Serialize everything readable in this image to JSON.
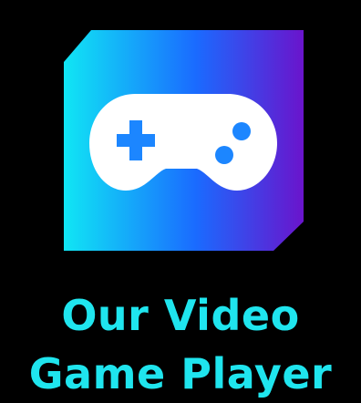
{
  "logo": {
    "icon": "gamepad-icon",
    "gradient": [
      "#10e6f4",
      "#1a6bff",
      "#6a14cc"
    ],
    "glyph_color": "#ffffff",
    "accent_color": "#1c86ff"
  },
  "heading": {
    "line1": "Our Video",
    "line2": "Game Player",
    "color": "#1fe5ee"
  }
}
